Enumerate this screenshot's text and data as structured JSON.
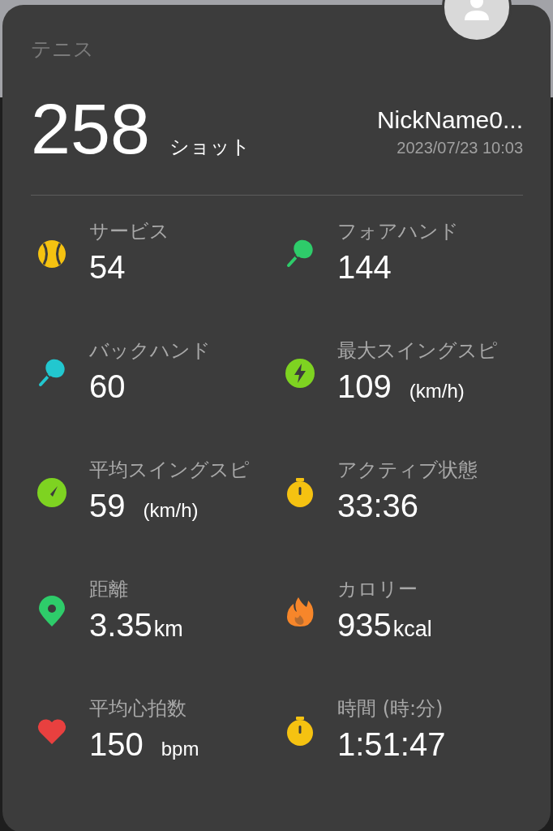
{
  "sport": "テニス",
  "shots": {
    "value": "258",
    "unit": "ショット"
  },
  "user": {
    "nickname": "NickName0...",
    "datetime": "2023/07/23 10:03"
  },
  "stats": [
    {
      "label": "サービス",
      "value": "54",
      "kind": "ball",
      "color": "#f5c211"
    },
    {
      "label": "フォアハンド",
      "value": "144",
      "kind": "racket",
      "color": "#2ecc6a"
    },
    {
      "label": "バックハンド",
      "value": "60",
      "kind": "racket",
      "color": "#22c7cf"
    },
    {
      "label": "最大スイングスピ",
      "value": "109",
      "unit": "(km/h)",
      "unit_gap": true,
      "kind": "bolt",
      "color": "#7ed321"
    },
    {
      "label": "平均スイングスピ",
      "value": "59",
      "unit": "(km/h)",
      "unit_gap": true,
      "kind": "gauge",
      "color": "#7ed321"
    },
    {
      "label": "アクティブ状態",
      "value": "33:36",
      "kind": "stopwatch",
      "color": "#f5c211"
    },
    {
      "label": "距離",
      "value": "3.35",
      "unit": "km",
      "unit_gap": false,
      "kind": "pin",
      "color": "#2ecc6a"
    },
    {
      "label": "カロリー",
      "value": "935",
      "unit": "kcal",
      "unit_gap": false,
      "kind": "flame",
      "color": "#f7862a"
    },
    {
      "label": "平均心拍数",
      "value": "150",
      "unit": "bpm",
      "unit_gap": true,
      "kind": "heart",
      "color": "#e8403f"
    },
    {
      "label": "時間 (時:分)",
      "value": "1:51:47",
      "kind": "stopwatch",
      "color": "#f5c211"
    }
  ]
}
